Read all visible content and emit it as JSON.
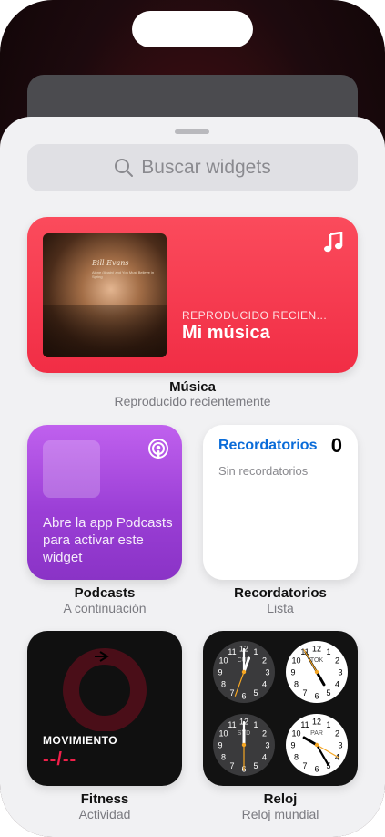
{
  "search": {
    "placeholder": "Buscar widgets"
  },
  "music": {
    "album_title": "Bill Evans",
    "album_subtitle": "Alone (Again) and You Must Believe in Spring",
    "subtitle": "REPRODUCIDO RECIEN...",
    "title": "Mi música",
    "caption_title": "Música",
    "caption_sub": "Reproducido recientemente",
    "accent": "#f12d45"
  },
  "podcasts": {
    "text": "Abre la app Podcasts para activar este widget",
    "caption_title": "Podcasts",
    "caption_sub": "A continuación",
    "accent": "#9b3fd6"
  },
  "reminders": {
    "title": "Recordatorios",
    "count": "0",
    "empty": "Sin recordatorios",
    "caption_title": "Recordatorios",
    "caption_sub": "Lista",
    "accent": "#0a6cd9"
  },
  "fitness": {
    "label": "MOVIMIENTO",
    "value": "--/--",
    "caption_title": "Fitness",
    "caption_sub": "Actividad",
    "accent": "#f0204a"
  },
  "clock": {
    "caption_title": "Reloj",
    "caption_sub": "Reloj mundial",
    "cities": [
      {
        "code": "CUP",
        "theme": "dark"
      },
      {
        "code": "TOK",
        "theme": "light"
      },
      {
        "code": "SYD",
        "theme": "dark"
      },
      {
        "code": "PAR",
        "theme": "light"
      }
    ]
  }
}
